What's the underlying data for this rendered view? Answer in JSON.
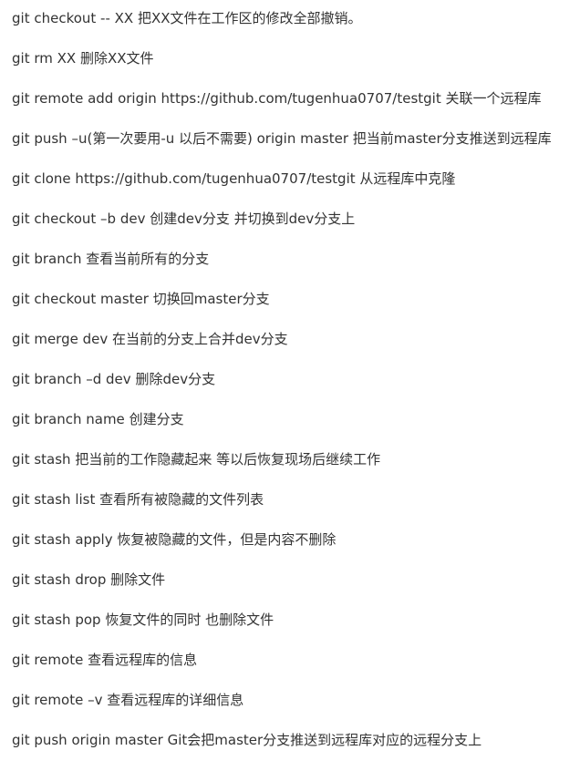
{
  "lines": [
    {
      "cmd": "git checkout -- XX",
      "desc": "把XX文件在工作区的修改全部撤销。"
    },
    {
      "cmd": "git rm XX",
      "desc": "删除XX文件"
    },
    {
      "cmd": "git remote add origin https://github.com/tugenhua0707/testgit",
      "desc": "关联一个远程库"
    },
    {
      "cmd": "git push –u(第一次要用-u 以后不需要) origin master",
      "desc": "把当前master分支推送到远程库"
    },
    {
      "cmd": "git clone https://github.com/tugenhua0707/testgit",
      "desc": "从远程库中克隆"
    },
    {
      "cmd": "git checkout –b dev",
      "desc": "创建dev分支 并切换到dev分支上"
    },
    {
      "cmd": "git branch",
      "desc": "查看当前所有的分支"
    },
    {
      "cmd": "git checkout master",
      "desc": "切换回master分支"
    },
    {
      "cmd": "git merge dev",
      "desc": "在当前的分支上合并dev分支"
    },
    {
      "cmd": "git branch –d dev",
      "desc": "删除dev分支"
    },
    {
      "cmd": "git branch name",
      "desc": "创建分支"
    },
    {
      "cmd": "git stash",
      "desc": "把当前的工作隐藏起来 等以后恢复现场后继续工作"
    },
    {
      "cmd": "git stash list",
      "desc": "查看所有被隐藏的文件列表"
    },
    {
      "cmd": "git stash apply",
      "desc": "恢复被隐藏的文件，但是内容不删除"
    },
    {
      "cmd": "git stash drop",
      "desc": "删除文件"
    },
    {
      "cmd": "git stash pop",
      "desc": "恢复文件的同时 也删除文件"
    },
    {
      "cmd": "git remote",
      "desc": "查看远程库的信息"
    },
    {
      "cmd": "git remote –v",
      "desc": "查看远程库的详细信息"
    },
    {
      "cmd": "git push origin master",
      "desc": "Git会把master分支推送到远程库对应的远程分支上"
    }
  ]
}
